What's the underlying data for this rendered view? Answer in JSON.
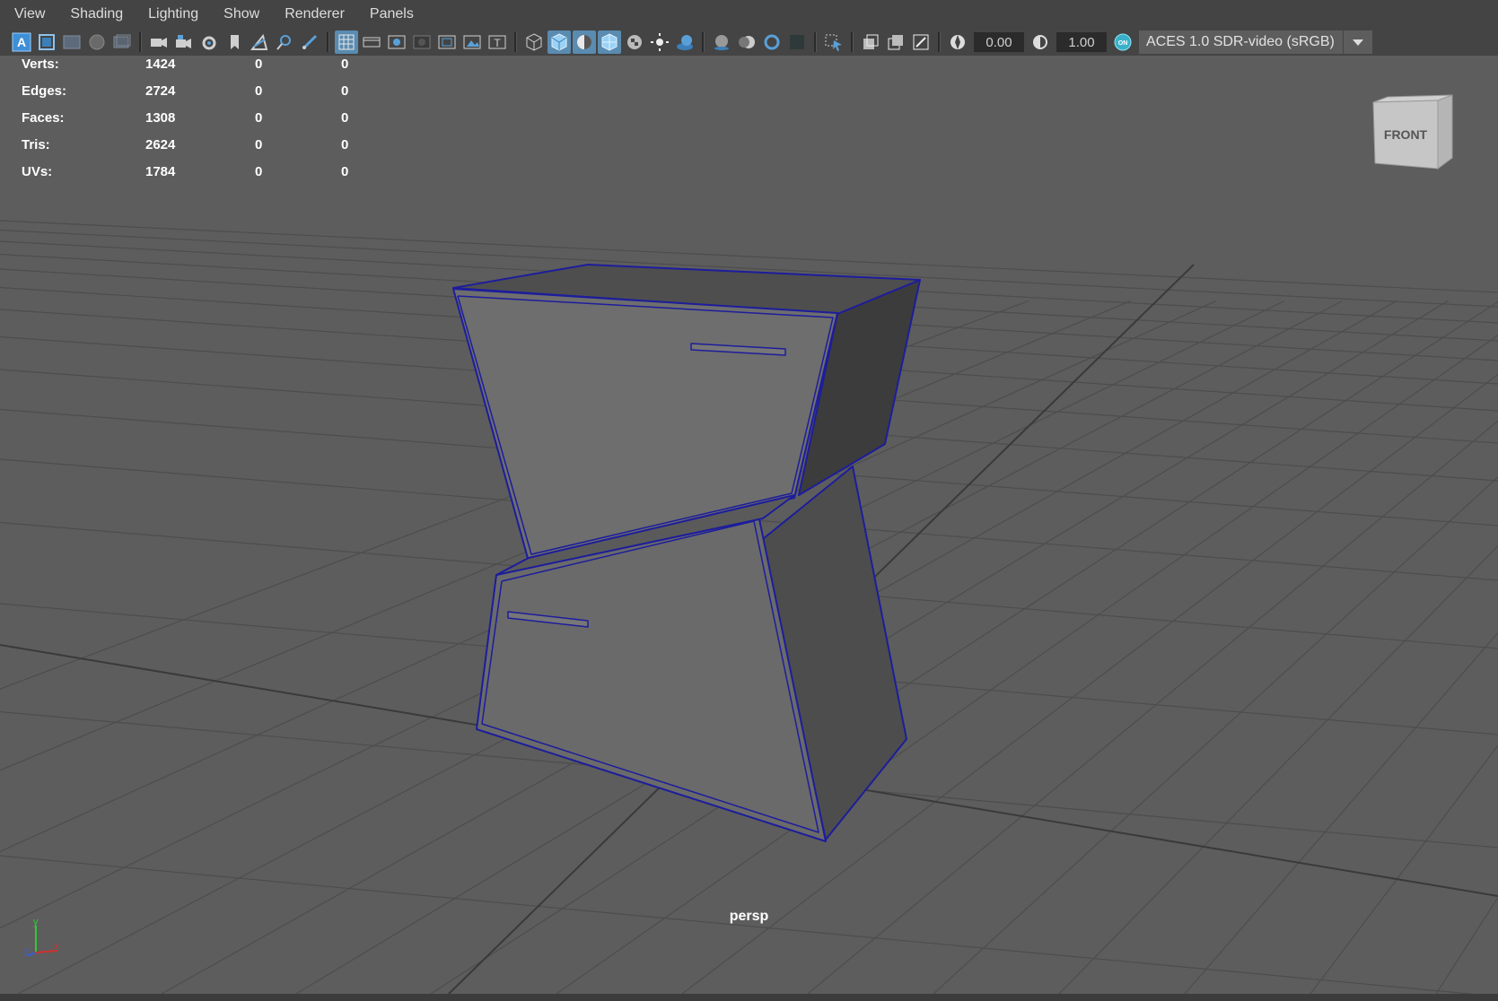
{
  "menu": [
    "View",
    "Shading",
    "Lighting",
    "Show",
    "Renderer",
    "Panels"
  ],
  "toolbar": {
    "icons": [
      "select-camera-icon",
      "image-plane-icon",
      "grid-toggle-icon",
      "film-gate-icon",
      "resolution-gate-icon",
      "camera-icon",
      "camera-attributes-icon",
      "camera-settings-icon",
      "bookmark-icon",
      "grease-pencil-icon",
      "2d-pan-zoom-icon",
      "paint-icon"
    ],
    "exposure": "0.00",
    "gamma": "1.00",
    "color_management_badge": "ON",
    "color_space": "ACES 1.0 SDR-video (sRGB)"
  },
  "hud": {
    "rows": [
      {
        "label": "Verts:",
        "v1": "1424",
        "v2": "0",
        "v3": "0"
      },
      {
        "label": "Edges:",
        "v1": "2724",
        "v2": "0",
        "v3": "0"
      },
      {
        "label": "Faces:",
        "v1": "1308",
        "v2": "0",
        "v3": "0"
      },
      {
        "label": "Tris:",
        "v1": "2624",
        "v2": "0",
        "v3": "0"
      },
      {
        "label": "UVs:",
        "v1": "1784",
        "v2": "0",
        "v3": "0"
      }
    ]
  },
  "viewcube": {
    "face_label": "FRONT"
  },
  "camera_label": "persp",
  "axis": {
    "x": "x",
    "y": "y",
    "z": "z"
  },
  "colors": {
    "viewport_bg": "#5d5d5d",
    "grid": "#4a4a4a",
    "wire": "#1a1aa0",
    "ui_bg": "#444444",
    "active_button": "#5a8bb0"
  }
}
